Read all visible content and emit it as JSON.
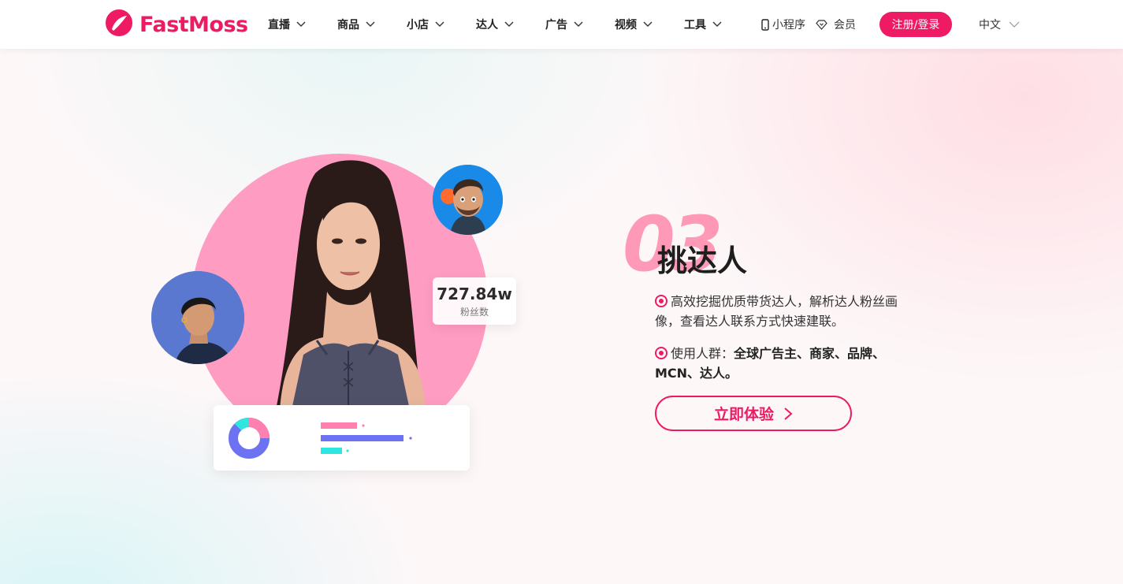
{
  "header": {
    "logo_text": "FastMoss",
    "nav": [
      {
        "label": "直播"
      },
      {
        "label": "商品"
      },
      {
        "label": "小店"
      },
      {
        "label": "达人"
      },
      {
        "label": "广告"
      },
      {
        "label": "视频"
      },
      {
        "label": "工具"
      }
    ],
    "mini_program": "小程序",
    "member": "会员",
    "login": "注册/登录",
    "language": "中文"
  },
  "hero": {
    "section_number": "03",
    "title": "挑达人",
    "desc1": "高效挖掘优质带货达人，解析达人粉丝画像，查看达人联系方式快速建联。",
    "desc2_prefix": "使用人群：",
    "desc2_bold": "全球广告主、商家、品牌、MCN、达人。",
    "cta": "立即体验",
    "fans_value": "727.84w",
    "fans_label": "粉丝数"
  },
  "colors": {
    "brand": "#ee1a64",
    "circle": "#ff9cc2"
  },
  "icons": [
    "logo-icon",
    "chevron-down-icon",
    "phone-icon",
    "diamond-icon",
    "radio-dot-icon",
    "chevron-right-icon"
  ]
}
